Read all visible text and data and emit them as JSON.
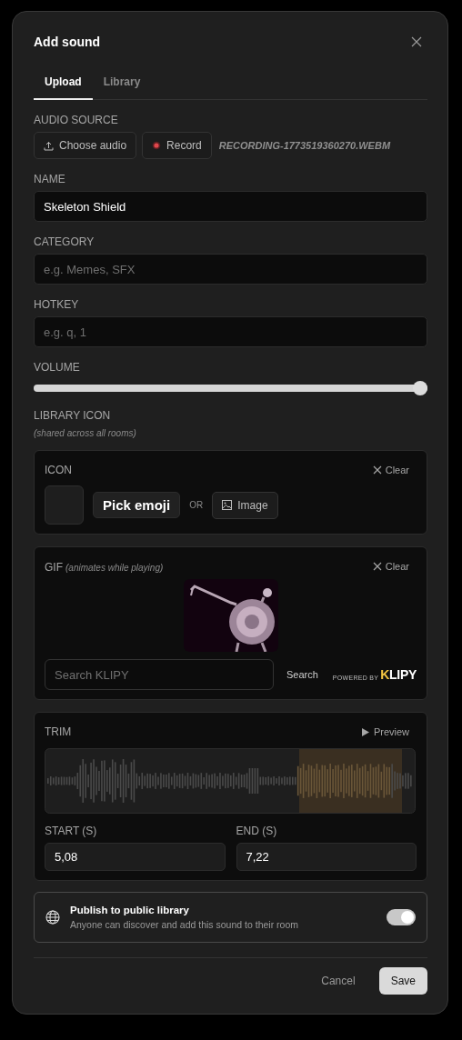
{
  "dialog": {
    "title": "Add sound"
  },
  "tabs": [
    {
      "label": "Upload",
      "selected": true
    },
    {
      "label": "Library",
      "selected": false
    }
  ],
  "audio_source": {
    "label": "AUDIO SOURCE",
    "choose_button": "Choose audio",
    "record_button": "Record",
    "file_name": "RECORDING-1773519360270.WEBM"
  },
  "fields": [
    {
      "label": "NAME",
      "value": "Skeleton Shield"
    },
    {
      "label": "CATEGORY",
      "placeholder": "e.g. Memes, SFX"
    },
    {
      "label": "HOTKEY",
      "placeholder": "e.g. q, 1"
    }
  ],
  "volume": {
    "label": "VOLUME",
    "level": 1.0
  },
  "library_icon": {
    "label": "LIBRARY ICON",
    "note": "(shared across all rooms)"
  },
  "icon_card": {
    "label": "ICON",
    "clear": "Clear",
    "pick_button": "Pick emoji",
    "or": "OR",
    "image_button": "Image"
  },
  "gif_card": {
    "label": "GIF",
    "note": "(animates while playing)",
    "clear": "Clear",
    "search_placeholder": "Search KLIPY",
    "search_button": "Search",
    "powered_by": "POWERED BY",
    "logo": "KLIPY"
  },
  "trim": {
    "label": "TRIM",
    "preview": "Preview",
    "start_label": "START (S)",
    "start_value": "5,08",
    "end_label": "END (S)",
    "end_value": "7,22"
  },
  "publish": {
    "title": "Publish to public library",
    "description": "Anyone can discover and add this sound to their room",
    "on": true
  },
  "footer": {
    "cancel": "Cancel",
    "save": "Save"
  }
}
